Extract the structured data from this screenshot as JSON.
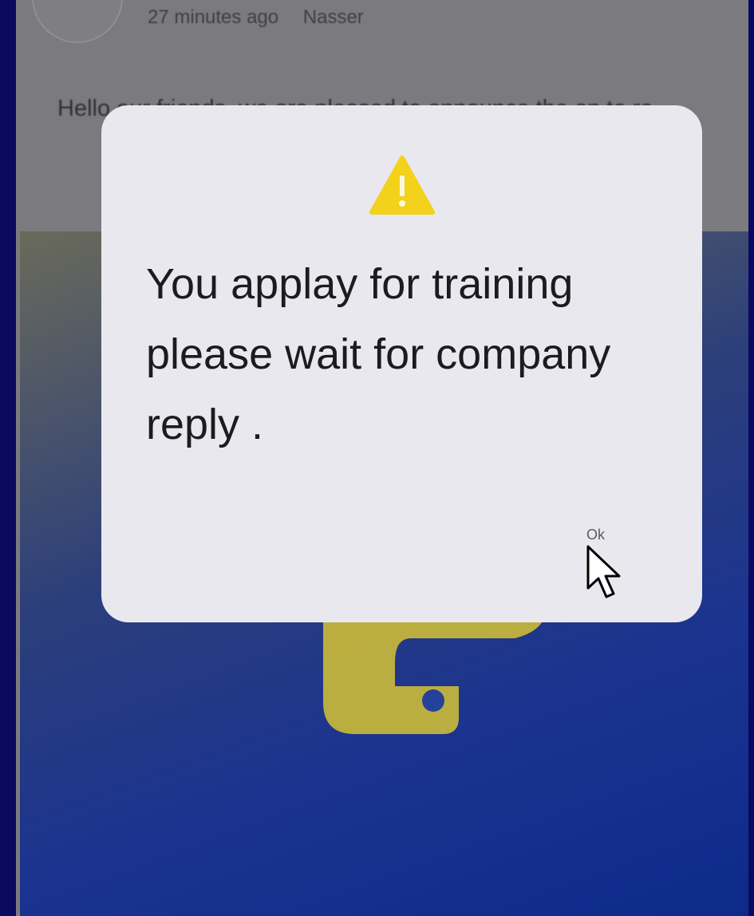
{
  "post": {
    "time_ago": "27 minutes ago",
    "author": "Nasser",
    "body": "Hello our friends, we are pleased to announce the op                                                                    to re"
  },
  "dialog": {
    "icon": "warning-icon",
    "message": "You applay for training please wait for company reply .",
    "ok_label": "Ok"
  },
  "colors": {
    "warning": "#f2d21a",
    "dialog_bg": "#e9e8ef",
    "outer_bg": "#0a0a5e"
  }
}
